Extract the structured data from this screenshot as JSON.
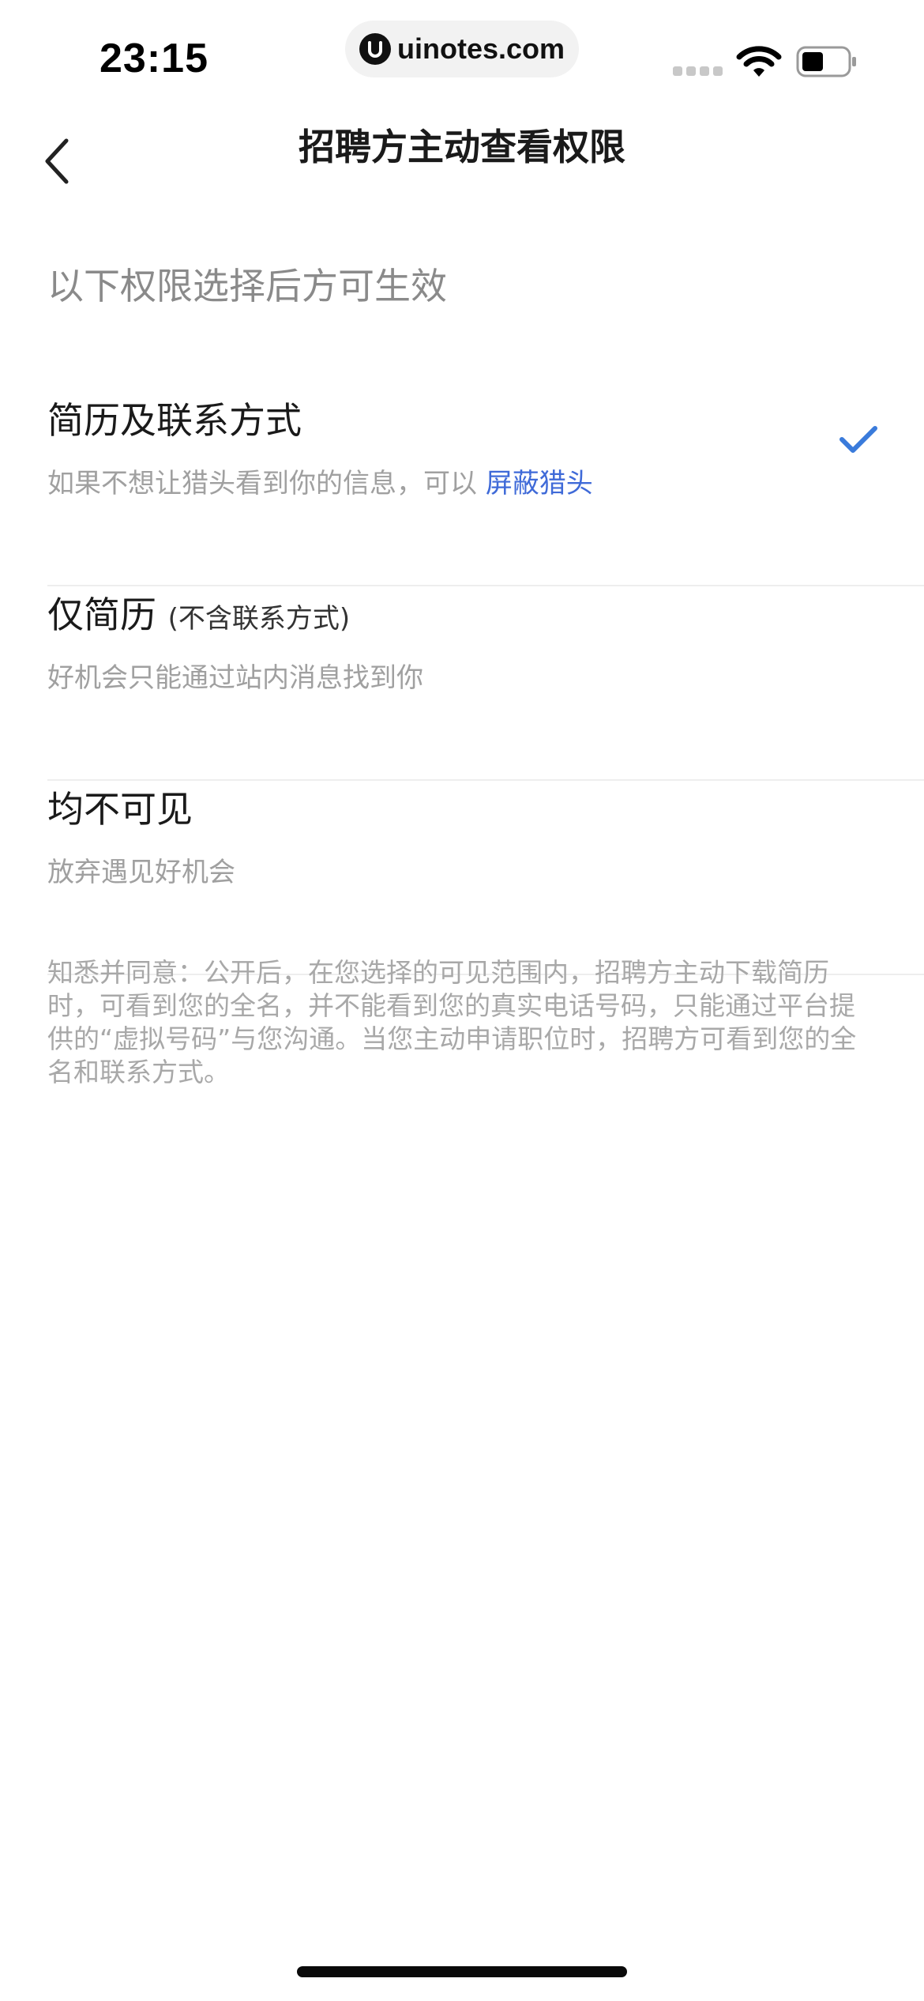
{
  "status_bar": {
    "time": "23:15",
    "watermark": "uinotes.com"
  },
  "nav": {
    "title": "招聘方主动查看权限"
  },
  "hint": "以下权限选择后方可生效",
  "options": [
    {
      "title": "简历及联系方式",
      "desc_prefix": "如果不想让猎头看到你的信息，可以 ",
      "desc_link": "屏蔽猎头",
      "selected": true
    },
    {
      "title": "仅简历",
      "title_sub": "(不含联系方式)",
      "desc": "好机会只能通过站内消息找到你",
      "selected": false
    },
    {
      "title": "均不可见",
      "desc": "放弃遇见好机会",
      "selected": false
    }
  ],
  "notice": "知悉并同意：公开后，在您选择的可见范围内，招聘方主动下载简历时，可看到您的全名，并不能看到您的真实电话号码，只能通过平台提供的“虚拟号码”与您沟通。当您主动申请职位时，招聘方可看到您的全名和联系方式。",
  "colors": {
    "accent": "#3f6ad8",
    "check": "#3a7bdb",
    "text_secondary": "#a0a0a0"
  },
  "icons": {
    "back": "chevron-left-icon",
    "selected": "checkmark-icon"
  }
}
